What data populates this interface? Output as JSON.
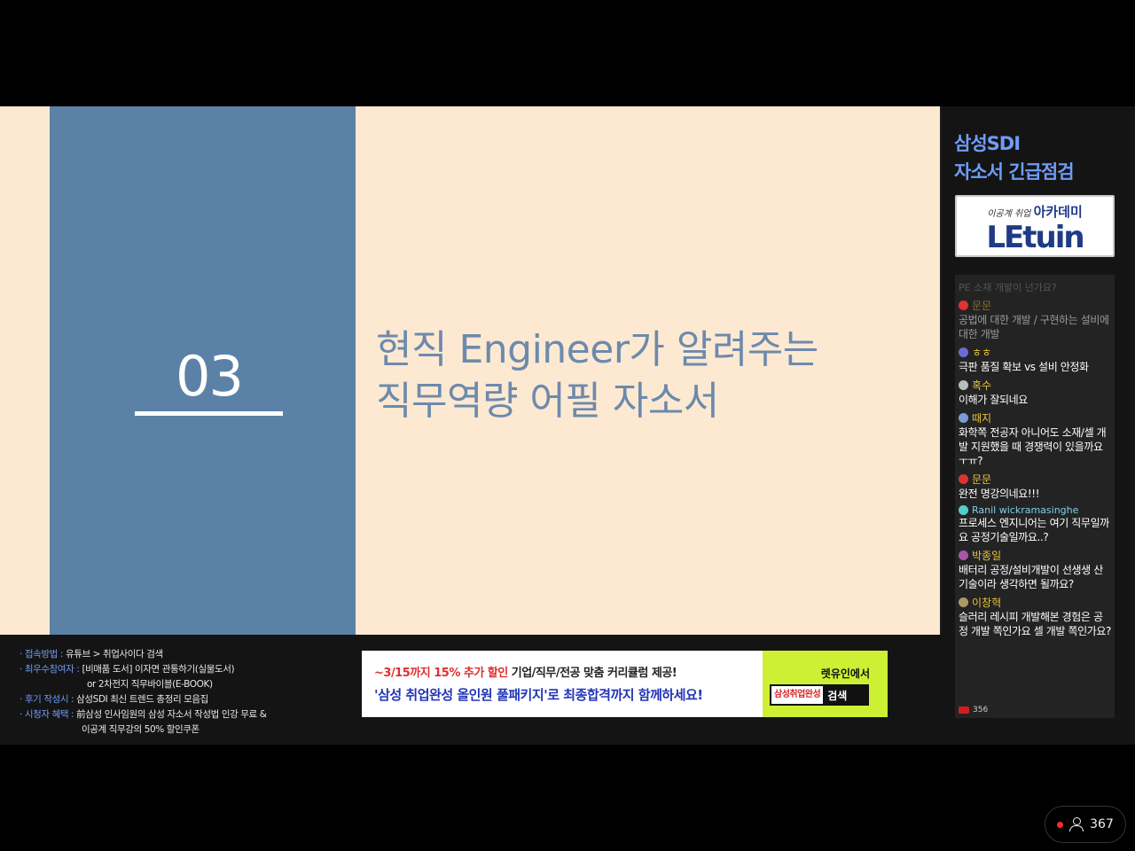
{
  "slide": {
    "number": "03",
    "title_line1": "현직 Engineer가 알려주는",
    "title_line2": "직무역량 어필 자소서"
  },
  "side": {
    "title_line1": "삼성SDI",
    "title_line2": "자소서 긴급점검",
    "logo_sub": "이공계 취업",
    "logo_sub_bold": "아카데미",
    "logo_main": "LEtuin"
  },
  "chat": {
    "faded_text": "PE 소재 개발이 넌가요?",
    "messages": [
      {
        "author": "문문",
        "text": "공법에 대한 개발 / 구현하는 설비에 대한 개발",
        "color": "#d33"
      },
      {
        "author": "ㅎㅎ",
        "text": "극판 품질 확보 vs 설비 안정화",
        "color": "#6b6bd8"
      },
      {
        "author": "혹수",
        "text": "이해가 잘되네요",
        "color": "#bbb"
      },
      {
        "author": "때지",
        "text": "화학쪽 전공자 아니어도 소재/셀 개발 지원했을 때 경쟁력이 있을까요ㅜㅠ?",
        "color": "#7b9bd6"
      },
      {
        "author": "문문",
        "text": "완전 명강의네요!!!",
        "color": "#d33"
      },
      {
        "author": "Ranil wickramasinghe",
        "text": "프로세스 엔지니어는 여기 직무일까요 공정기술일까요..?",
        "color": "#5cc"
      },
      {
        "author": "박종일",
        "text": "배터리 공정/설비개발이 선생생 산기술이라 생각하면 될까요?",
        "color": "#a5a"
      },
      {
        "author": "이창혁",
        "text": "슬러리 레시피 개발해본 경험은 공정 개발 쪽인가요 셀 개발 쪽인가요?",
        "color": "#a96"
      }
    ],
    "count": "356"
  },
  "info": {
    "l1_label": "· 접속방법 :",
    "l1_text": "유튜브 > 취업사이다 검색",
    "l2_label": "· 최우수참여자 :",
    "l2_text": "[비매품 도서] 이자면 관통하기(실물도서)",
    "l3_text": "or 2차전지 직무바이블(E-BOOK)",
    "l4_label": "· 후기 작성시 :",
    "l4_text": "삼성SDI 최신 트렌드 총정리 모음집",
    "l5_label": "· 시청자 혜택 :",
    "l5_text": "前삼성 인사임원의 삼성 자소서 작성법 인강 무료 &",
    "l6_text": "이공계 직무강의 50% 할인쿠폰"
  },
  "banner": {
    "line1_red": "~3/15까지 15% 추가 할인",
    "line1_rest": " 기업/직무/전공 맞춤 커리큘럼 제공!",
    "line2": "'삼성 취업완성 올인원 풀패키지'로 최종합격까지 함께하세요!",
    "right_top": "렛유인에서",
    "search_term": "삼성취업완성",
    "search_btn": "검색"
  },
  "viewers": {
    "count": "367"
  }
}
